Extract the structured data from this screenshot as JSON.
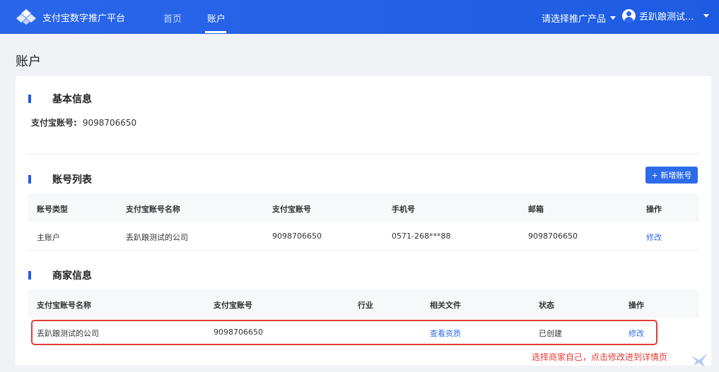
{
  "header": {
    "title": "支付宝数字推广平台",
    "nav": [
      {
        "label": "首页",
        "active": false
      },
      {
        "label": "账户",
        "active": true
      }
    ],
    "product_select": "请选择推广产品",
    "user_name": "丢趴踉测试..."
  },
  "page_title": "账户",
  "basic_info": {
    "heading": "基本信息",
    "account_label": "支付宝账号:",
    "account_value": "9098706650"
  },
  "account_list": {
    "heading": "账号列表",
    "add_button": "+ 新增账号",
    "columns": [
      "账号类型",
      "支付宝账号名称",
      "支付宝账号",
      "手机号",
      "邮箱",
      "操作"
    ],
    "rows": [
      {
        "type": "主账户",
        "name": "丢趴踉测试的公司",
        "account": "9098706650",
        "phone": "0571-268***88",
        "email": "9098706650",
        "action": "修改"
      }
    ]
  },
  "merchant_info": {
    "heading": "商家信息",
    "columns": [
      "支付宝账号名称",
      "支付宝账号",
      "行业",
      "相关文件",
      "状态",
      "操作"
    ],
    "rows": [
      {
        "name": "丢趴踉测试的公司",
        "account": "9098706650",
        "industry": "",
        "files": "查看资质",
        "status": "已创建",
        "action": "修改"
      }
    ]
  },
  "annotation": "选择商家自己，点击修改进到详情页",
  "colors": {
    "primary": "#1f5ce0",
    "link": "#2d6ce8",
    "annotation": "#e53935"
  }
}
